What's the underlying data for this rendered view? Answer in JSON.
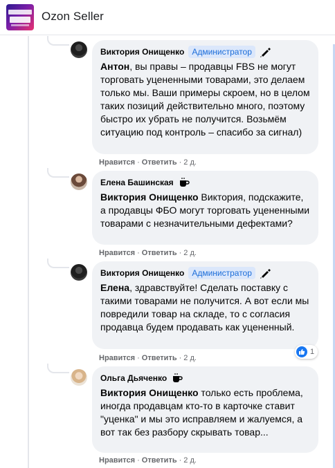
{
  "header": {
    "group_name": "Ozon Seller"
  },
  "comments": [
    {
      "author": "Виктория Онищенко",
      "badge": "Администратор",
      "mention": "Антон",
      "text": ", вы правы – продавцы FBS не могут торговать уцененными товарами, это делаем только мы. Ваши примеры скроем, но в целом таких позиций действительно много, поэтому быстро их убрать не получится. Возьмём ситуацию под контроль – спасибо за сигнал)",
      "like": "Нравится",
      "reply": "Ответить",
      "time": "2 д."
    },
    {
      "author": "Елена Башинская",
      "mention": "Виктория Онищенко",
      "text": " Виктория, подскажите, а продавцы ФБО могут торговать уцененными товарами с незначительными дефектами?",
      "like": "Нравится",
      "reply": "Ответить",
      "time": "2 д."
    },
    {
      "author": "Виктория Онищенко",
      "badge": "Администратор",
      "mention": "Елена",
      "text": ", здравствуйте! Сделать поставку с такими товарами не получится. А вот если мы повредили товар на складе, то с согласия продавца будем продавать как уцененный.",
      "like": "Нравится",
      "reply": "Ответить",
      "time": "2 д.",
      "reaction_count": "1"
    },
    {
      "author": "Ольга Дьяченко",
      "mention": "Виктория Онищенко",
      "text": " только есть проблема, иногда продавцам кто-то в карточке ставит \"уценка\" и мы это исправляем и жалуемся, а вот так без разбору скрывать товар...",
      "like": "Нравится",
      "reply": "Ответить",
      "time": "2 д."
    }
  ],
  "colors": {
    "bubble": "#f0f2f5",
    "badge_bg": "#dbe7fb",
    "badge_text": "#1b6dd9",
    "meta": "#65676b",
    "like": "#1877f2"
  }
}
